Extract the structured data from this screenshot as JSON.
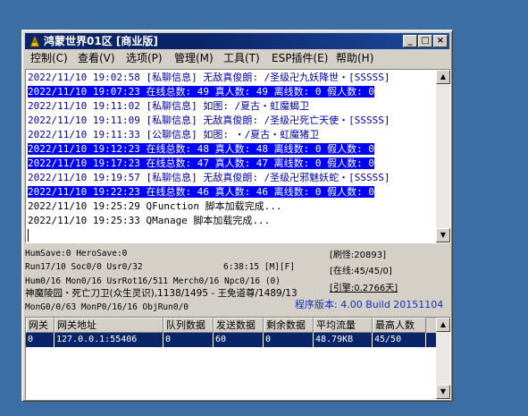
{
  "window": {
    "title": "鸿蒙世界01区 [商业版]",
    "buttons": {
      "minimize": "_",
      "maximize": "□",
      "close": "×"
    }
  },
  "menu": [
    {
      "label": "控制(C)"
    },
    {
      "label": "查看(V)"
    },
    {
      "label": "选项(P)"
    },
    {
      "label": "管理(M)"
    },
    {
      "label": "工具(T)"
    },
    {
      "label": "ESP插件(E)"
    },
    {
      "label": "帮助(H)"
    }
  ],
  "log": [
    {
      "text": "2022/11/10 19:02:58 [私聊信息] 无敌真俊朗: /圣级卍九妖降世・[SSSSS]",
      "style": "blue"
    },
    {
      "text": "2022/11/10 19:07:23 在线总数: 49 真人数: 49 离线数: 0 假人数: 0",
      "style": "hl"
    },
    {
      "text": "2022/11/10 19:11:02 [私聊信息] 如图: /夏古・虹魔蝎卫",
      "style": "blue"
    },
    {
      "text": "2022/11/10 19:11:09 [私聊信息] 无敌真俊朗: /圣级卍死亡天使・[SSSSS]",
      "style": "blue"
    },
    {
      "text": "2022/11/10 19:11:33 [公聊信息] 如图: ・/夏古・虹魔猪卫",
      "style": "blue"
    },
    {
      "text": "2022/11/10 19:12:23 在线总数: 48 真人数: 48 离线数: 0 假人数: 0",
      "style": "hl"
    },
    {
      "text": "2022/11/10 19:17:23 在线总数: 47 真人数: 47 离线数: 0 假人数: 0",
      "style": "hl"
    },
    {
      "text": "2022/11/10 19:19:57 [私聊信息] 无敌真俊朗: /圣级卍邪魅妖蛇・[SSSSS]",
      "style": "blue"
    },
    {
      "text": "2022/11/10 19:22:23 在线总数: 46 真人数: 46 离线数: 0 假人数: 0",
      "style": "hl"
    },
    {
      "text": "2022/11/10 19:25:29 QFunction 脚本加载完成...",
      "style": "black"
    },
    {
      "text": "2022/11/10 19:25:33 QManage 脚本加载完成...",
      "style": "black"
    }
  ],
  "status": {
    "line1": "HumSave:0 HeroSave:0",
    "line2": "Run17/10 Soc0/0 Usr0/32",
    "time": "6:38:15 [M][F]",
    "line3": "Hum0/16 Mon0/16 UsrRot16/511 Merch0/16 Npc0/16 (0)",
    "monster_line": "神魔陵园・死亡刀卫(众生灵识),1138/1495 - 王免道尊/1489/13",
    "line5": "MonG0/0/63 MonP0/16/16 ObjRun0/0",
    "refresh": "[刷怪:20893]",
    "online": "[在线:45/45/0]",
    "engine": "[引擎:0.2766天]",
    "version": "程序版本: 4.00 Build 20151104"
  },
  "grid": {
    "headers": [
      "网关",
      "网关地址",
      "队列数据",
      "发送数据",
      "剩余数据",
      "平均流量",
      "最高人数"
    ],
    "rows": [
      [
        "0",
        "127.0.0.1:55406",
        "0",
        "60",
        "0",
        "48.79KB",
        "45/50"
      ]
    ]
  }
}
